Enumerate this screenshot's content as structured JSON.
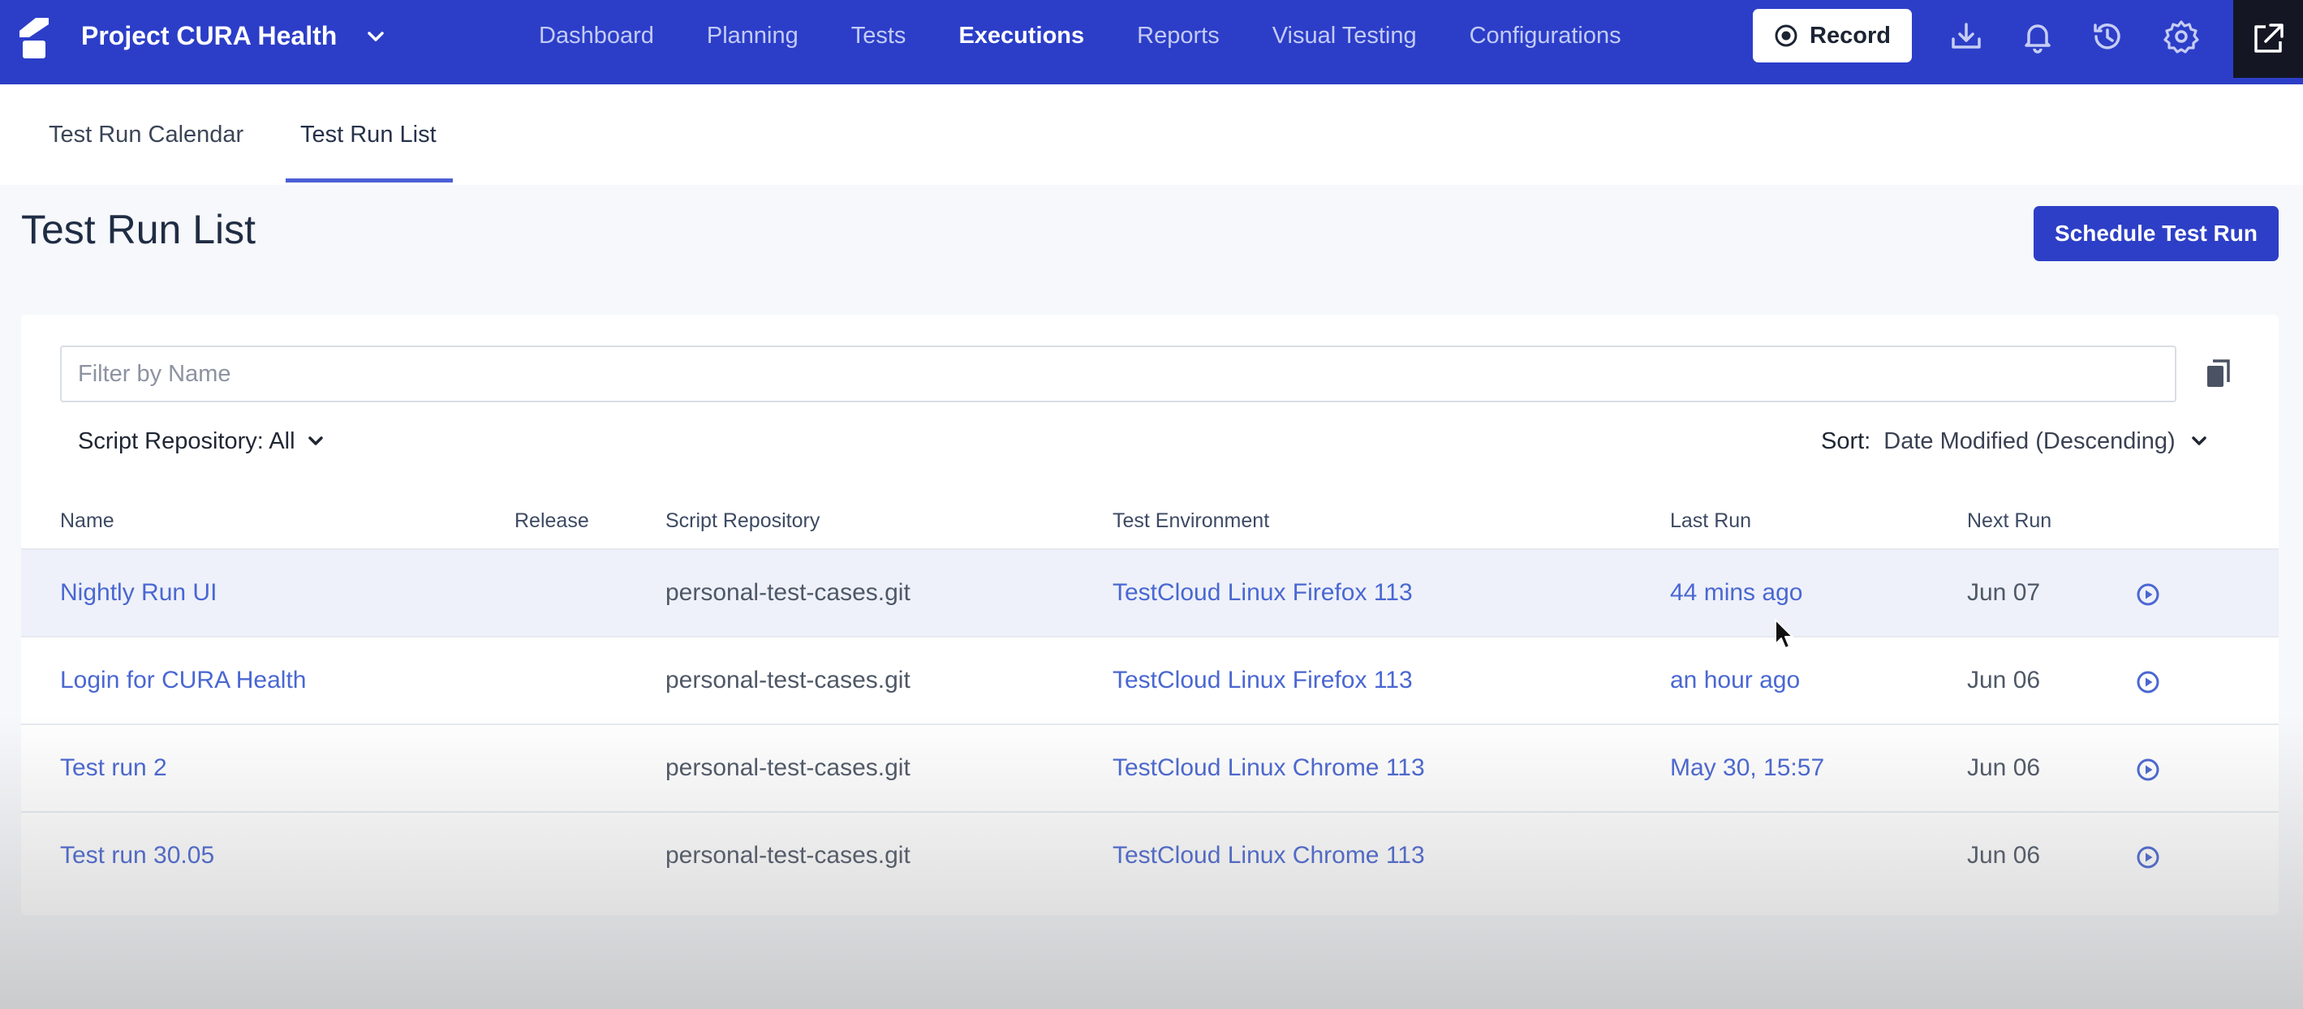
{
  "project": {
    "name": "Project CURA Health"
  },
  "nav": {
    "items": [
      {
        "label": "Dashboard",
        "active": false
      },
      {
        "label": "Planning",
        "active": false
      },
      {
        "label": "Tests",
        "active": false
      },
      {
        "label": "Executions",
        "active": true
      },
      {
        "label": "Reports",
        "active": false
      },
      {
        "label": "Visual Testing",
        "active": false
      },
      {
        "label": "Configurations",
        "active": false
      }
    ],
    "record_label": "Record"
  },
  "tabs": [
    {
      "label": "Test Run Calendar",
      "active": false
    },
    {
      "label": "Test Run List",
      "active": true
    }
  ],
  "page": {
    "title": "Test Run List",
    "schedule_button": "Schedule Test Run"
  },
  "filter": {
    "placeholder": "Filter by Name",
    "repo_label": "Script Repository: All",
    "sort_label": "Sort:",
    "sort_value": "Date Modified (Descending)"
  },
  "table": {
    "columns": [
      "Name",
      "Release",
      "Script Repository",
      "Test Environment",
      "Last Run",
      "Next Run"
    ],
    "rows": [
      {
        "name": "Nightly Run UI",
        "release": "",
        "repo": "personal-test-cases.git",
        "env": "TestCloud Linux Firefox 113",
        "last_run": "44 mins ago",
        "next_run": "Jun 07"
      },
      {
        "name": "Login for CURA Health",
        "release": "",
        "repo": "personal-test-cases.git",
        "env": "TestCloud Linux Firefox 113",
        "last_run": "an hour ago",
        "next_run": "Jun 06"
      },
      {
        "name": "Test run 2",
        "release": "",
        "repo": "personal-test-cases.git",
        "env": "TestCloud Linux Chrome 113",
        "last_run": "May 30, 15:57",
        "next_run": "Jun 06"
      },
      {
        "name": "Test run 30.05",
        "release": "",
        "repo": "personal-test-cases.git",
        "env": "TestCloud Linux Chrome 113",
        "last_run": "",
        "next_run": "Jun 06"
      }
    ]
  },
  "icons": {
    "brand": "brand-logo-icon",
    "download": "download-icon",
    "notifications": "bell-icon",
    "history": "history-icon",
    "settings": "gear-icon",
    "external": "external-link-icon",
    "copy": "copy-icon",
    "run": "play-circle-icon"
  },
  "colors": {
    "topbar": "#2c3ec8",
    "primary_button": "#2d3fc6",
    "link": "#4a67d2"
  }
}
